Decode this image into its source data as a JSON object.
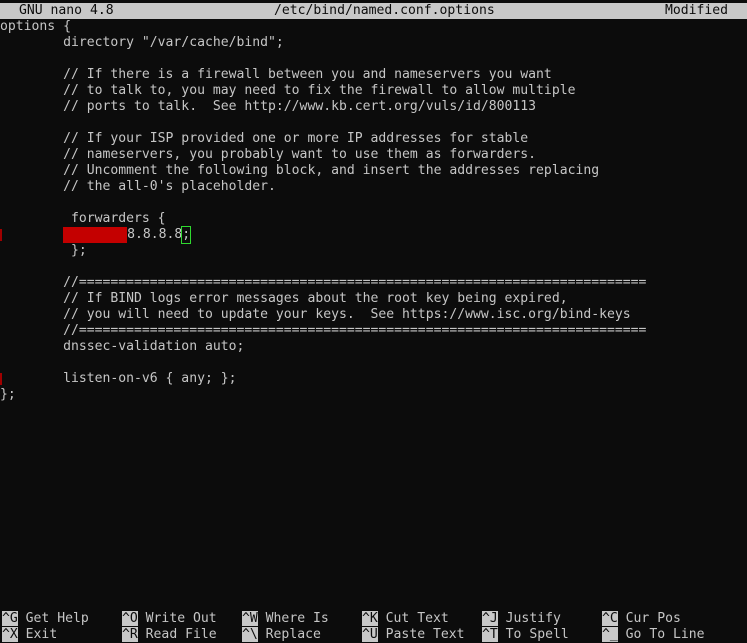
{
  "titlebar": {
    "app": "GNU nano 4.8",
    "file": "/etc/bind/named.conf.options",
    "status": "Modified"
  },
  "editor": {
    "lines": [
      "options {",
      "        directory \"/var/cache/bind\";",
      "",
      "        // If there is a firewall between you and nameservers you want",
      "        // to talk to, you may need to fix the firewall to allow multiple",
      "        // ports to talk.  See http://www.kb.cert.org/vuls/id/800113",
      "",
      "        // If your ISP provided one or more IP addresses for stable",
      "        // nameservers, you probably want to use them as forwarders.",
      "        // Uncomment the following block, and insert the addresses replacing",
      "        // the all-0's placeholder.",
      "",
      "         forwarders {",
      "",
      "         };",
      "",
      "        //========================================================================",
      "        // If BIND logs error messages about the root key being expired,",
      "        // you will need to update your keys.  See https://www.isc.org/bind-keys",
      "        //========================================================================",
      "        dnssec-validation auto;",
      "",
      "        listen-on-v6 { any; };",
      "};"
    ],
    "forwarder_value": "8.8.8.8",
    "forwarder_semicolon": ";",
    "redacted": "████████"
  },
  "shortcuts": [
    {
      "key": "^G",
      "label": "Get Help"
    },
    {
      "key": "^O",
      "label": "Write Out"
    },
    {
      "key": "^W",
      "label": "Where Is"
    },
    {
      "key": "^K",
      "label": "Cut Text"
    },
    {
      "key": "^J",
      "label": "Justify"
    },
    {
      "key": "^C",
      "label": "Cur Pos"
    },
    {
      "key": "^X",
      "label": "Exit"
    },
    {
      "key": "^R",
      "label": "Read File"
    },
    {
      "key": "^\\",
      "label": "Replace"
    },
    {
      "key": "^U",
      "label": "Paste Text"
    },
    {
      "key": "^T",
      "label": "To Spell"
    },
    {
      "key": "^_",
      "label": "Go To Line"
    }
  ]
}
